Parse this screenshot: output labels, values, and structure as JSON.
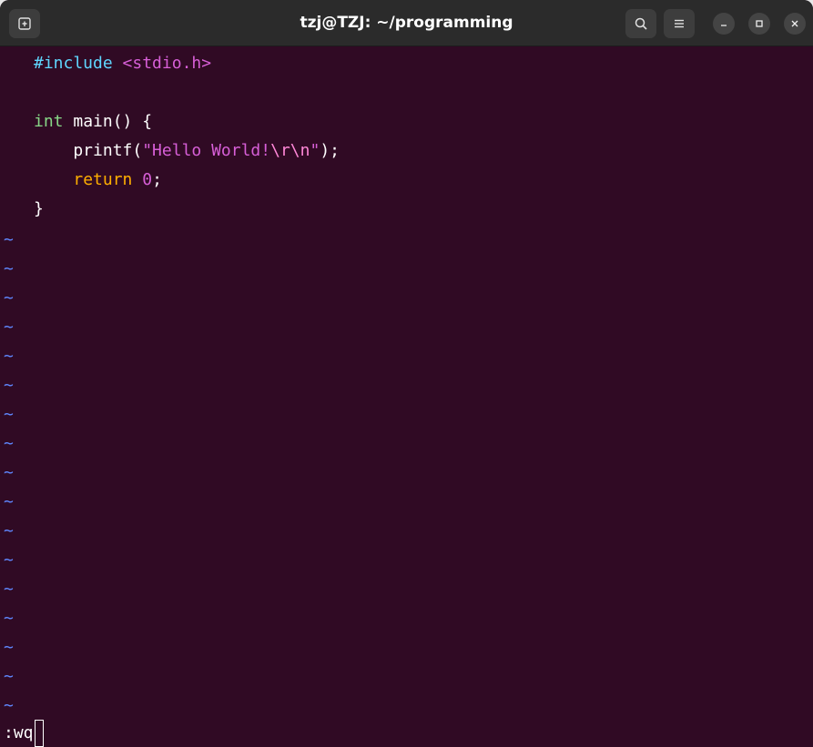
{
  "window": {
    "title": "tzj@TZJ: ~/programming"
  },
  "toolbar": {
    "new_tab_icon": "new-tab-icon",
    "search_icon": "search-icon",
    "menu_icon": "hamburger-menu-icon",
    "minimize_icon": "minimize-icon",
    "maximize_icon": "maximize-icon",
    "close_icon": "close-icon"
  },
  "editor": {
    "lines": [
      {
        "tokens": [
          {
            "text": "#include ",
            "kind": "pre"
          },
          {
            "text": "<stdio.h>",
            "kind": "inc"
          }
        ]
      },
      {
        "tokens": []
      },
      {
        "tokens": [
          {
            "text": "int",
            "kind": "type"
          },
          {
            "text": " main() ",
            "kind": "fn"
          },
          {
            "text": "{",
            "kind": "match"
          }
        ]
      },
      {
        "tokens": [
          {
            "text": "    printf(",
            "kind": "fn"
          },
          {
            "text": "\"Hello World!",
            "kind": "str"
          },
          {
            "text": "\\r\\n",
            "kind": "esc"
          },
          {
            "text": "\"",
            "kind": "str"
          },
          {
            "text": ");",
            "kind": "fn"
          }
        ]
      },
      {
        "tokens": [
          {
            "text": "    ",
            "kind": "fn"
          },
          {
            "text": "return",
            "kind": "kw"
          },
          {
            "text": " ",
            "kind": "fn"
          },
          {
            "text": "0",
            "kind": "num"
          },
          {
            "text": ";",
            "kind": "fn"
          }
        ]
      },
      {
        "tokens": [
          {
            "text": "}",
            "kind": "match"
          }
        ]
      }
    ],
    "tilde_char": "~",
    "tilde_count": 17,
    "command": ":wq"
  },
  "colors": {
    "background": "#300a24",
    "titlebar": "#2b2b2b",
    "tilde": "#5f87ff",
    "bracket_match": "#2aa1b3"
  }
}
